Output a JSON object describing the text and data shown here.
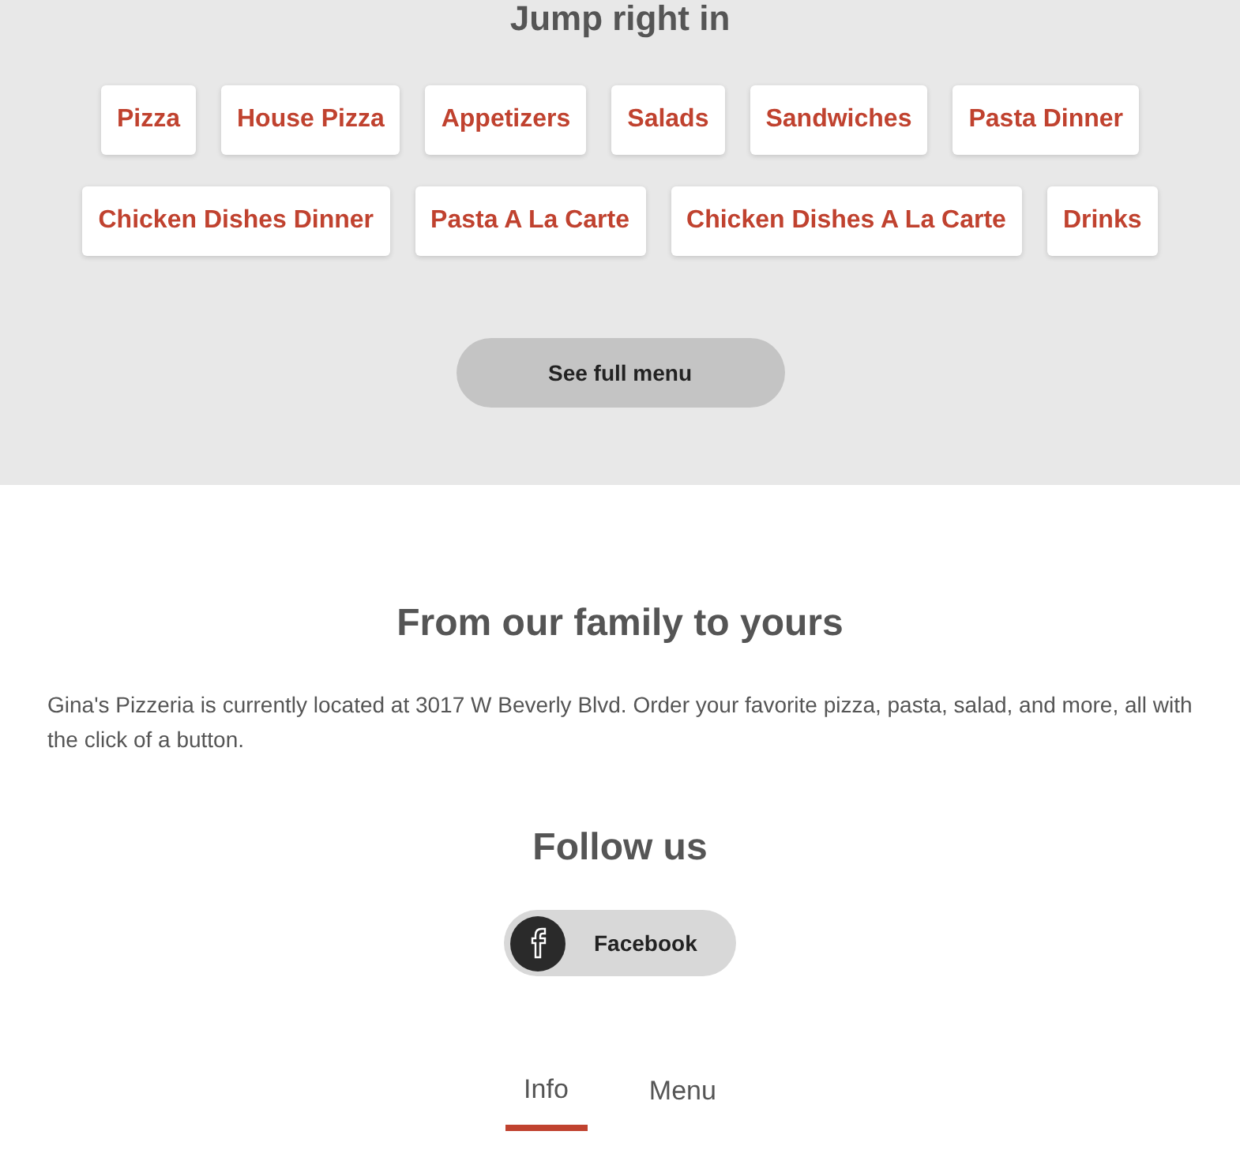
{
  "menu_section": {
    "heading": "Jump right in",
    "categories": [
      "Pizza",
      "House Pizza",
      "Appetizers",
      "Salads",
      "Sandwiches",
      "Pasta Dinner",
      "Chicken Dishes Dinner",
      "Pasta A La Carte",
      "Chicken Dishes A La Carte",
      "Drinks"
    ],
    "full_menu_button": "See full menu"
  },
  "about": {
    "heading": "From our family to yours",
    "text": "Gina's Pizzeria is currently located at 3017 W Beverly Blvd. Order your favorite pizza, pasta, salad, and more, all with the click of a button."
  },
  "follow": {
    "heading": "Follow us",
    "links": [
      {
        "label": "Facebook"
      }
    ]
  },
  "tabs": [
    {
      "label": "Info",
      "selected": true
    },
    {
      "label": "Menu",
      "selected": false
    }
  ]
}
